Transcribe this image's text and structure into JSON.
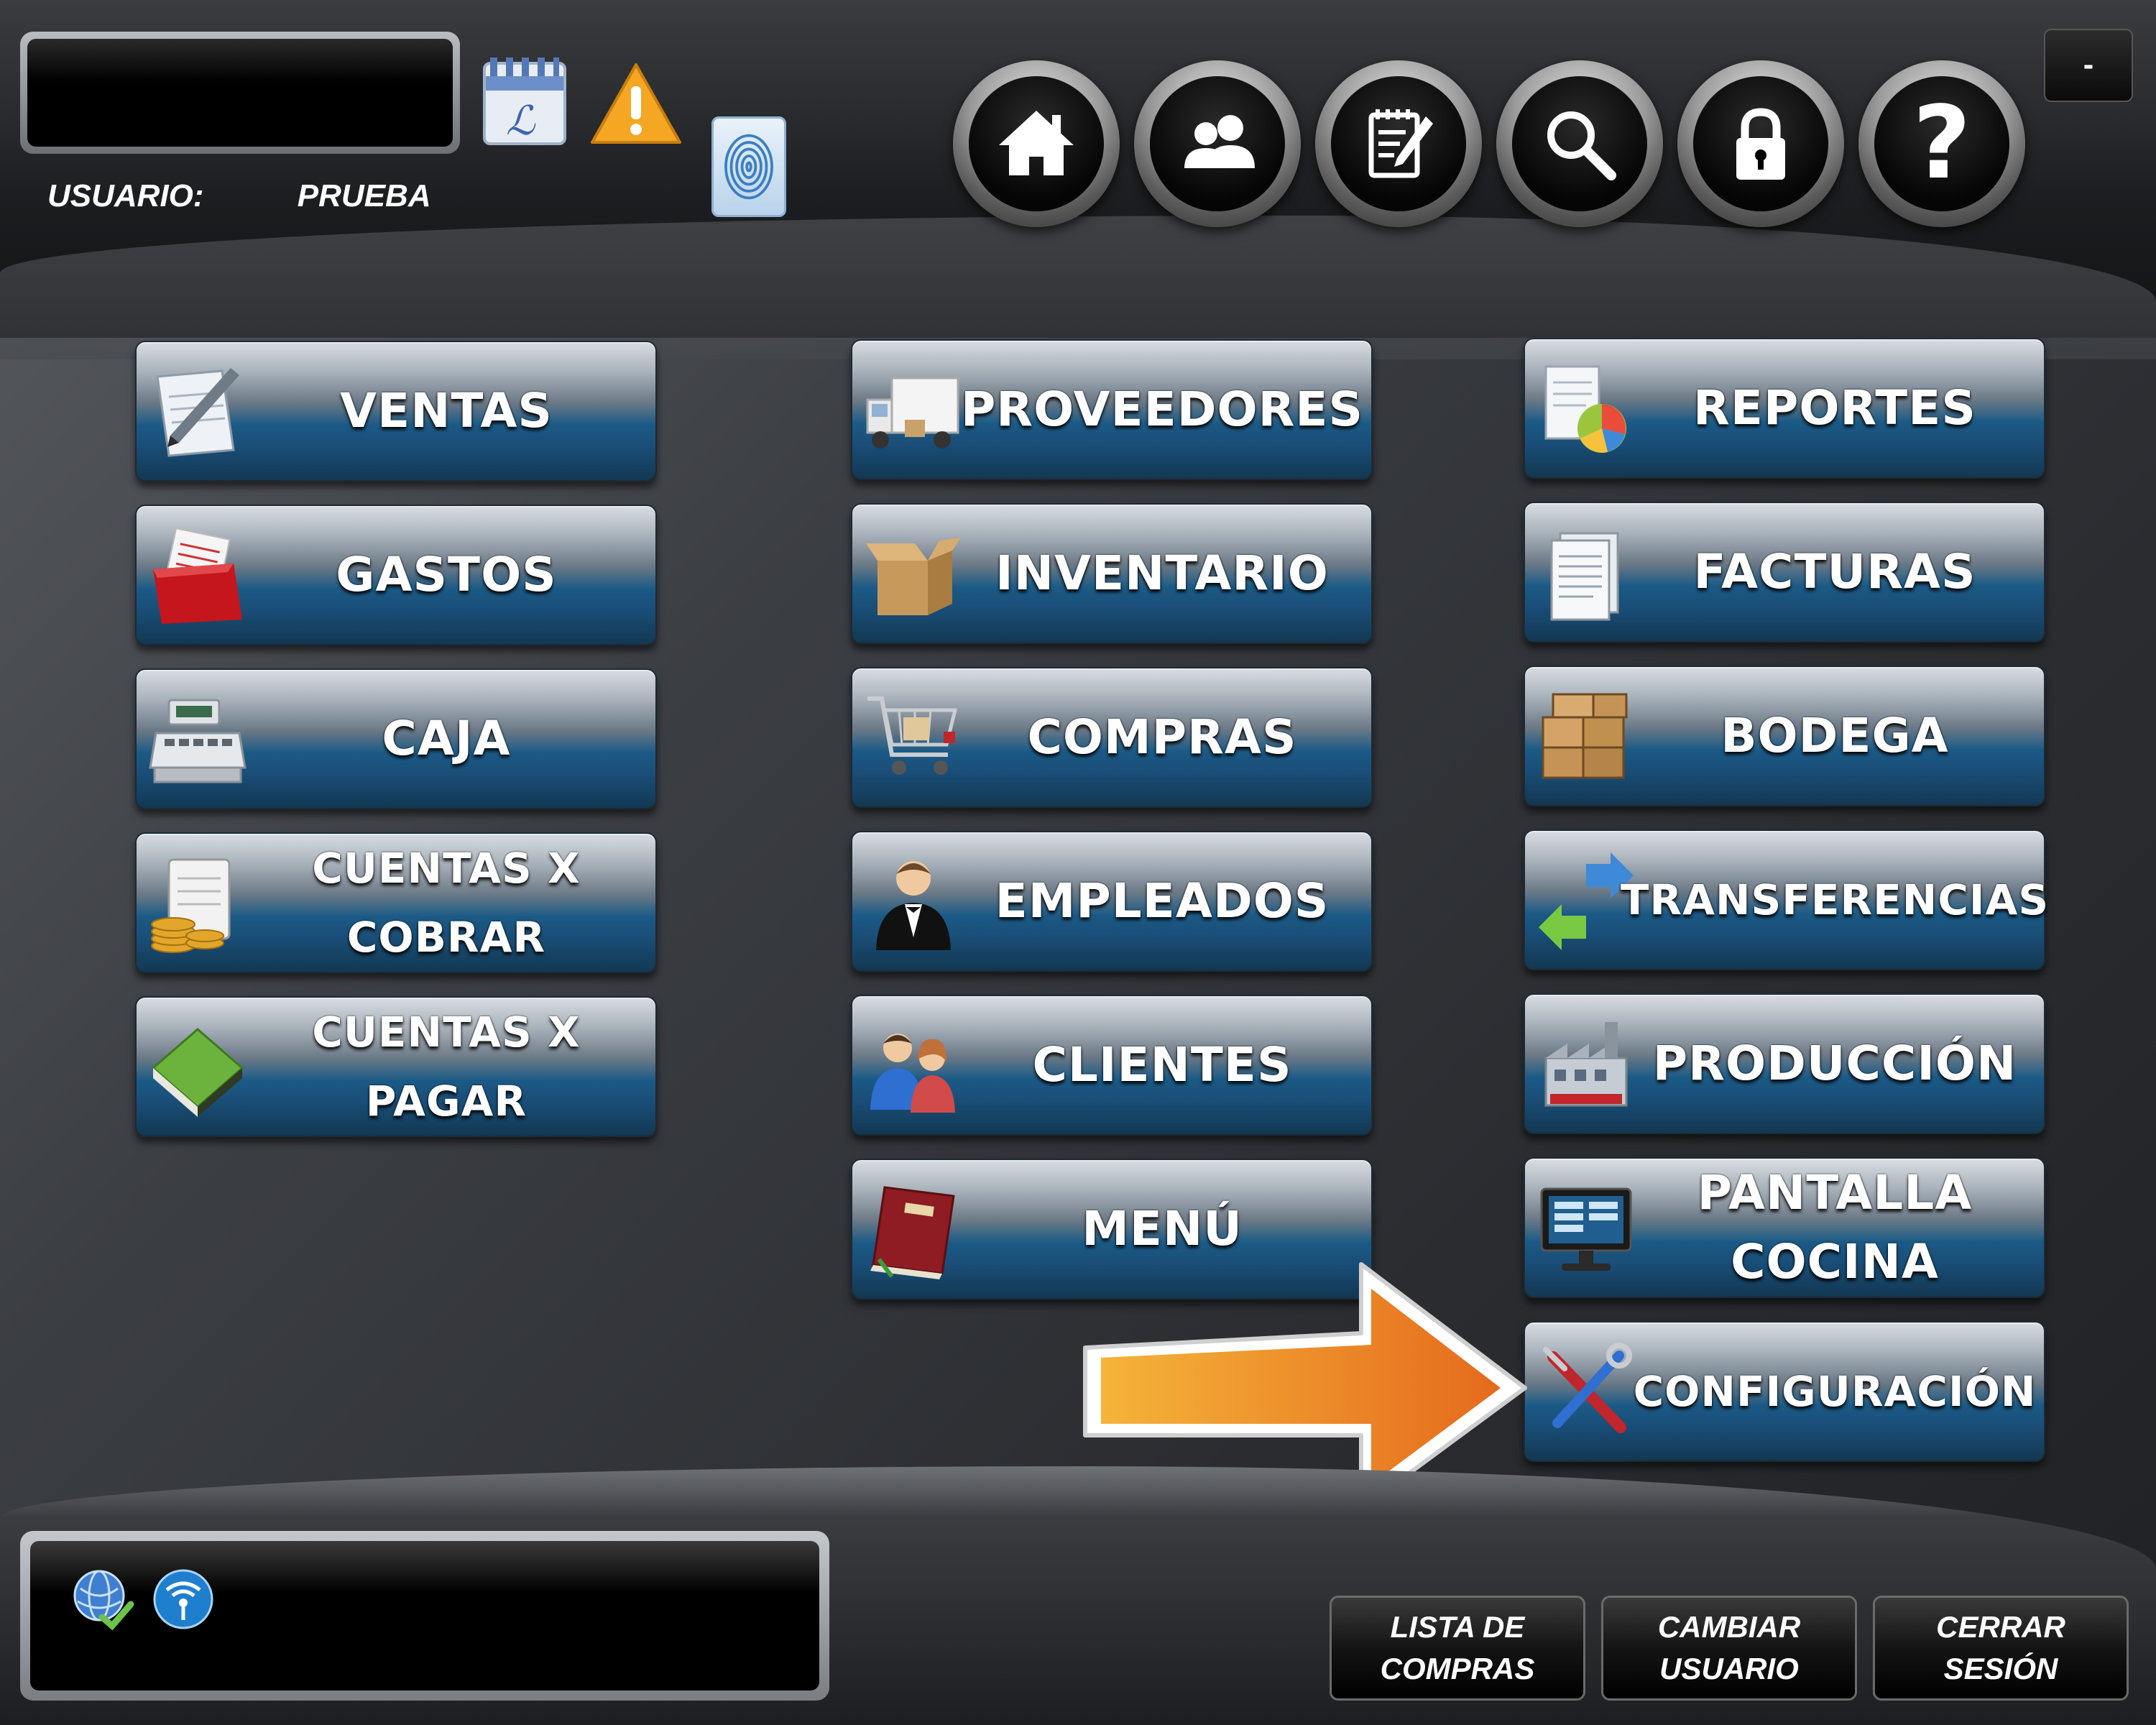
{
  "header": {
    "user_label": "USUARIO:",
    "user_value": "PRUEBA",
    "status_icons": [
      "calendar-icon",
      "warning-icon",
      "fingerprint-icon"
    ],
    "nav_buttons": [
      {
        "name": "home",
        "icon": "home-icon"
      },
      {
        "name": "users",
        "icon": "users-icon"
      },
      {
        "name": "notes",
        "icon": "notepad-icon"
      },
      {
        "name": "search",
        "icon": "search-icon"
      },
      {
        "name": "lock",
        "icon": "lock-icon"
      },
      {
        "name": "help",
        "icon": "help-icon",
        "glyph": "?"
      }
    ],
    "minimize_label": "-"
  },
  "modules": {
    "ventas": "VENTAS",
    "gastos": "GASTOS",
    "caja": "CAJA",
    "cuentas_cobrar": "CUENTAS X\nCOBRAR",
    "cuentas_pagar": "CUENTAS X\nPAGAR",
    "proveedores": "PROVEEDORES",
    "inventario": "INVENTARIO",
    "compras": "COMPRAS",
    "empleados": "EMPLEADOS",
    "clientes": "CLIENTES",
    "menu": "MENÚ",
    "reportes": "REPORTES",
    "facturas": "FACTURAS",
    "bodega": "BODEGA",
    "transferencias": "TRANSFERENCIAS",
    "produccion": "PRODUCCIÓN",
    "pantalla_cocina": "PANTALLA\nCOCINA",
    "configuracion": "CONFIGURACIÓN"
  },
  "footer": {
    "lista_compras": "LISTA DE\nCOMPRAS",
    "cambiar_usuario": "CAMBIAR\nUSUARIO",
    "cerrar_sesion": "CERRAR\nSESIÓN",
    "status_icons": [
      "globe-check-icon",
      "wifi-icon"
    ]
  },
  "colors": {
    "accent_arrow": "#f0a02a",
    "button_blue": "#1b5a86"
  }
}
